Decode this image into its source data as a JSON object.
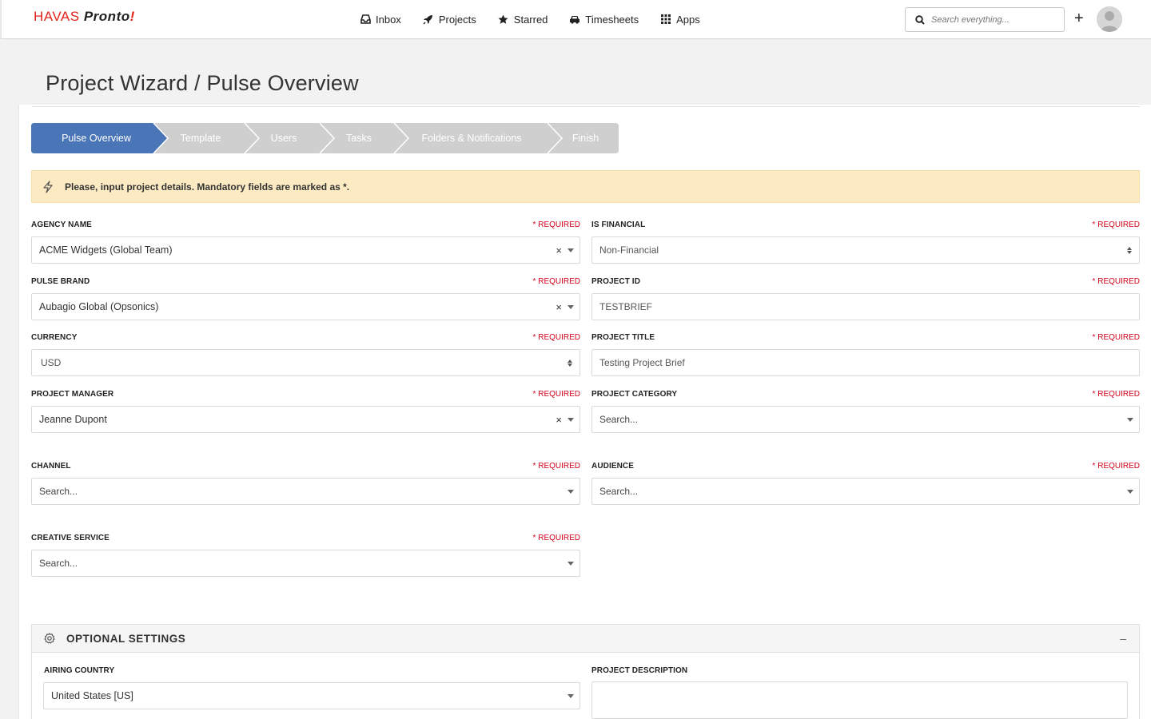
{
  "header": {
    "logo_havas": "HAVAS",
    "logo_pronto": "Pronto",
    "logo_bolt": "!",
    "nav": [
      {
        "label": "Inbox",
        "icon": "inbox-icon"
      },
      {
        "label": "Projects",
        "icon": "rocket-icon"
      },
      {
        "label": "Starred",
        "icon": "star-icon"
      },
      {
        "label": "Timesheets",
        "icon": "car-icon"
      },
      {
        "label": "Apps",
        "icon": "grid-icon"
      }
    ],
    "search_placeholder": "Search everything...",
    "add_label": "+"
  },
  "page": {
    "title": "Project Wizard / Pulse Overview"
  },
  "wizard": {
    "steps": [
      {
        "label": "Pulse Overview",
        "active": true
      },
      {
        "label": "Template",
        "active": false
      },
      {
        "label": "Users",
        "active": false
      },
      {
        "label": "Tasks",
        "active": false
      },
      {
        "label": "Folders & Notifications",
        "active": false
      },
      {
        "label": "Finish",
        "active": false
      }
    ],
    "colors": {
      "active": "#4a76b8",
      "inactive": "#cfcfcf"
    }
  },
  "alert": {
    "message": "Please, input project details. Mandatory fields are marked as *."
  },
  "form": {
    "required_label": "* REQUIRED",
    "agency_name": {
      "label": "AGENCY NAME",
      "value": "ACME Widgets (Global Team)"
    },
    "is_financial": {
      "label": "IS FINANCIAL",
      "value": "Non-Financial"
    },
    "pulse_brand": {
      "label": "PULSE BRAND",
      "value": "Aubagio Global (Opsonics)"
    },
    "project_id": {
      "label": "PROJECT ID",
      "value": "TESTBRIEF"
    },
    "currency": {
      "label": "CURRENCY",
      "value": "USD"
    },
    "project_title": {
      "label": "PROJECT TITLE",
      "value": "Testing Project Brief"
    },
    "project_manager": {
      "label": "PROJECT MANAGER",
      "value": "Jeanne Dupont"
    },
    "project_category": {
      "label": "PROJECT CATEGORY",
      "placeholder": "Search..."
    },
    "channel": {
      "label": "CHANNEL",
      "placeholder": "Search..."
    },
    "audience": {
      "label": "AUDIENCE",
      "placeholder": "Search..."
    },
    "creative_service": {
      "label": "CREATIVE SERVICE",
      "placeholder": "Search..."
    },
    "clear_glyph": "×"
  },
  "optional": {
    "title": "OPTIONAL SETTINGS",
    "collapse_glyph": "–",
    "airing_country": {
      "label": "AIRING COUNTRY",
      "value": "United States [US]"
    },
    "project_description": {
      "label": "PROJECT DESCRIPTION",
      "value": ""
    }
  },
  "colors": {
    "brand_red": "#e2231a",
    "required_red": "#d0021b",
    "alert_bg": "#fcebc2"
  }
}
